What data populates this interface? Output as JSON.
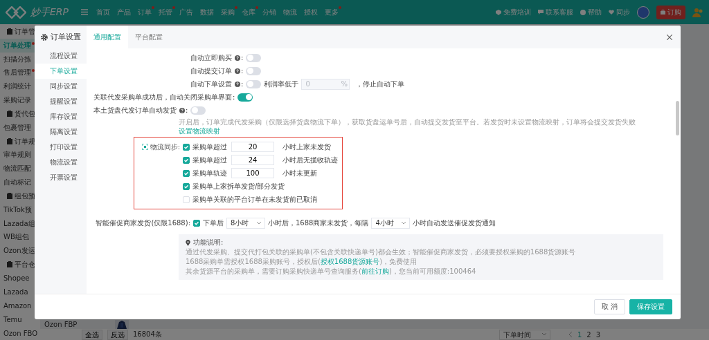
{
  "top_bar": {
    "logo": "妙手ERP",
    "nav": [
      {
        "label": "首页",
        "dot": false
      },
      {
        "label": "产品",
        "dot": false
      },
      {
        "label": "订单",
        "dot": true
      },
      {
        "label": "托管",
        "dot": true
      },
      {
        "label": "广告",
        "dot": false
      },
      {
        "label": "数据",
        "dot": false
      },
      {
        "label": "采购",
        "dot": true
      },
      {
        "label": "仓库",
        "dot": true
      },
      {
        "label": "分销",
        "dot": false
      },
      {
        "label": "物流",
        "dot": false
      },
      {
        "label": "授权",
        "dot": false
      },
      {
        "label": "更多",
        "dot": true
      }
    ],
    "links": [
      {
        "label": "免费培训",
        "kind": "training"
      },
      {
        "label": "联系客服",
        "kind": "chat"
      },
      {
        "label": "帮助",
        "kind": "help"
      },
      {
        "label": "同步",
        "kind": "sync"
      }
    ],
    "order_button": "订购"
  },
  "sidebar": {
    "items": [
      {
        "label": "订单管",
        "kind": "group"
      },
      {
        "label": "订单处理",
        "kind": "item",
        "selected": true,
        "dot": true
      },
      {
        "label": "扫描分拣",
        "kind": "item",
        "selected": false,
        "dot": false
      },
      {
        "label": "售后管理",
        "kind": "item",
        "selected": false,
        "dot": true
      },
      {
        "label": "利润统计",
        "kind": "item",
        "selected": false,
        "dot": false
      },
      {
        "label": "采购记录",
        "kind": "item",
        "selected": false,
        "dot": false
      },
      {
        "label": "货代包",
        "kind": "group"
      },
      {
        "label": "包裹管理",
        "kind": "item",
        "selected": false,
        "dot": false
      },
      {
        "label": "订单规",
        "kind": "group"
      },
      {
        "label": "审单规则",
        "kind": "item",
        "selected": false,
        "dot": false
      },
      {
        "label": "物流匹配",
        "kind": "item",
        "selected": false,
        "dot": false
      },
      {
        "label": "自动标记",
        "kind": "item",
        "selected": false,
        "dot": false
      },
      {
        "label": "组包预",
        "kind": "group"
      },
      {
        "label": "TikTok预",
        "kind": "item",
        "selected": false,
        "dot": false
      },
      {
        "label": "Lazada组",
        "kind": "item",
        "selected": false,
        "dot": false
      },
      {
        "label": "WB组包",
        "kind": "item",
        "selected": false,
        "dot": false
      },
      {
        "label": "Ozon发运",
        "kind": "item",
        "selected": false,
        "dot": false
      },
      {
        "label": "平台仓",
        "kind": "group"
      },
      {
        "label": "Shopee",
        "kind": "item",
        "selected": false,
        "dot": false
      },
      {
        "label": "Lazada",
        "kind": "item",
        "selected": false,
        "dot": false
      },
      {
        "label": "Amazon",
        "kind": "item",
        "selected": false,
        "dot": false
      },
      {
        "label": "Temu",
        "kind": "item",
        "selected": false,
        "dot": false
      },
      {
        "label": "Ozon FBO",
        "kind": "item",
        "selected": false,
        "dot": false
      }
    ]
  },
  "page_bottom": {
    "store": "Ozon FBP",
    "select_all": "全选",
    "invert": "反选",
    "count": "16804条",
    "sort": "下单时间",
    "pages": [
      {
        "label": "1",
        "selected": true
      },
      {
        "label": "2",
        "selected": false
      },
      {
        "label": "3",
        "selected": false
      }
    ]
  },
  "modal": {
    "title": "订单设置",
    "tabs": [
      {
        "label": "通用配置",
        "selected": true
      },
      {
        "label": "平台配置",
        "selected": false
      }
    ],
    "nav": [
      {
        "label": "流程设置",
        "selected": false
      },
      {
        "label": "下单设置",
        "selected": true
      },
      {
        "label": "同步设置",
        "selected": false
      },
      {
        "label": "提醒设置",
        "selected": false
      },
      {
        "label": "库存设置",
        "selected": false
      },
      {
        "label": "隔离设置",
        "selected": false
      },
      {
        "label": "打印设置",
        "selected": false
      },
      {
        "label": "物流设置",
        "selected": false
      },
      {
        "label": "开票设置",
        "selected": false
      }
    ],
    "toggles": [
      {
        "label": "自动立即购买",
        "help": true,
        "colon": ":",
        "on": false
      },
      {
        "label": "自动提交订单",
        "help": true,
        "colon": ":",
        "on": false
      },
      {
        "label": "自动下单设置",
        "help": true,
        "colon": ":",
        "on": false,
        "threshold": {
          "label": "利润率低于",
          "placeholder": "0",
          "unit": "%",
          "suffix": "，停止自动下单"
        }
      },
      {
        "label": "关联代发采购单成功后，自动关闭采购单界面",
        "help": false,
        "colon": ":",
        "on": true
      }
    ],
    "local_autoship": {
      "label": "本土货盘代发订单自动发货",
      "help": true,
      "colon": ":",
      "on": false,
      "description": "开启后，订单完成代发采购（仅限选择货盘物流下单），获取货盘运单号后，自动提交发货至平台。若发货时未设置物流映射，订单将会提交发货失败",
      "link": "设置物流映射"
    },
    "logistics_sync": {
      "label": "物流同步:",
      "rows": [
        {
          "checked": true,
          "label": "采购单超过",
          "value": "20",
          "unit": "小时上家未发货"
        },
        {
          "checked": true,
          "label": "采购单超过",
          "value": "24",
          "unit": "小时后无揽收轨迹"
        },
        {
          "checked": true,
          "label": "采购单轨迹",
          "value": "100",
          "unit": "小时未更新"
        },
        {
          "checked": true,
          "label": "采购单上家拆单发货/部分发货"
        },
        {
          "checked": false,
          "label": "采购单关联的平台订单在未发货前已取消"
        }
      ]
    },
    "urge": {
      "label": "智能催促商家发货(仅限1688):",
      "checked": true,
      "prefix": "下单后",
      "first": "8小时",
      "middle": "小时后，1688商家未发货，每隔",
      "second": "4小时",
      "suffix": "小时自动发送催促发货通知"
    },
    "info": {
      "title": "功能说明:",
      "lines": [
        [
          {
            "text": "通过代发采购、提交代打包关联的采购单(不包含关联快递单号)都会生效；智能催促商家发货，必须要授权采购的1688货源账号",
            "link": false
          }
        ],
        [
          {
            "text": "1688采购单需授权1688采购账号，授权后(",
            "link": false
          },
          {
            "text": "授权1688货源账号",
            "link": true
          },
          {
            "text": ")，免费使用",
            "link": false
          }
        ],
        [
          {
            "text": "其余货源平台的采购单，需要订购采购快递单号查询服务(",
            "link": false
          },
          {
            "text": "前往订购",
            "link": true
          },
          {
            "text": ")，您当前可用额度:100464",
            "link": false
          }
        ]
      ]
    },
    "buttons": [
      {
        "label": "取 消",
        "kind": "default"
      },
      {
        "label": "保存设置",
        "kind": "primary"
      }
    ]
  }
}
